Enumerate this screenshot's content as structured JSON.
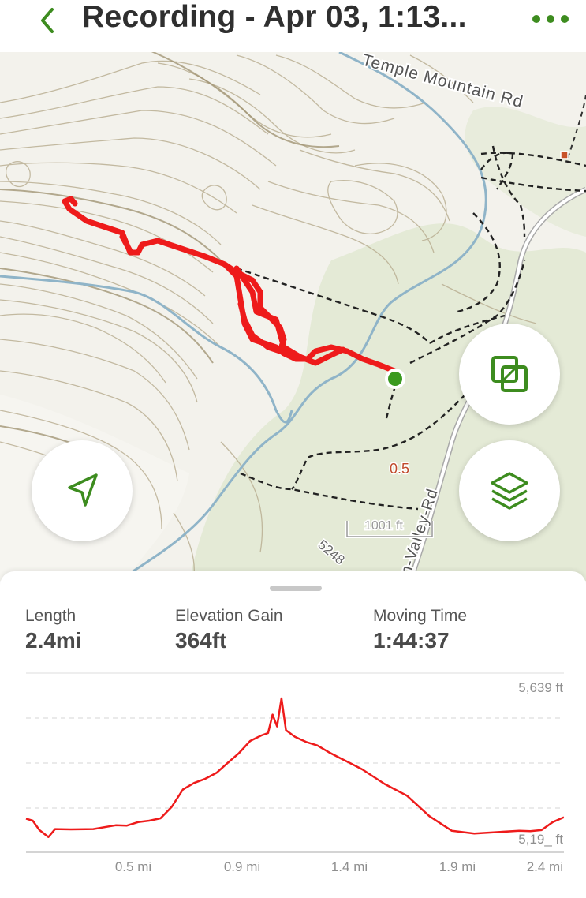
{
  "header": {
    "title": "Recording - Apr 03, 1:13...",
    "back_icon": "chevron-left-icon",
    "more_icon": "more-horizontal-icon",
    "accent_color": "#3d8c1f"
  },
  "map": {
    "road_1": "Temple Mountain Rd",
    "road_2": "n-Valley-Rd",
    "scale_label": "1001 ft",
    "mile_marker": "0.5",
    "contour_label": "5248",
    "track_color": "#ee1b1b",
    "buttons": {
      "locate_icon": "navigation-arrow-icon",
      "overlay_icon": "map-overlay-icon",
      "layers_icon": "layers-icon"
    }
  },
  "stats": {
    "length_label": "Length",
    "length_value": "2.4mi",
    "gain_label": "Elevation Gain",
    "gain_value": "364ft",
    "time_label": "Moving Time",
    "time_value": "1:44:37"
  },
  "chart_data": {
    "type": "line",
    "title": "",
    "xlabel": "",
    "ylabel": "",
    "x_ticks": [
      "0.5 mi",
      "0.9 mi",
      "1.4 mi",
      "1.9 mi",
      "2.4 mi"
    ],
    "y_ticks": [
      "5,639 ft",
      "5,19_ ft"
    ],
    "ylim": [
      5195,
      5639
    ],
    "xlim": [
      0,
      2.4
    ],
    "grid": true,
    "series": [
      {
        "color": "#ee1b1b",
        "x": [
          0.0,
          0.03,
          0.06,
          0.1,
          0.13,
          0.2,
          0.3,
          0.4,
          0.45,
          0.5,
          0.55,
          0.6,
          0.65,
          0.7,
          0.75,
          0.8,
          0.85,
          0.9,
          0.95,
          1.0,
          1.05,
          1.08,
          1.1,
          1.12,
          1.14,
          1.16,
          1.2,
          1.25,
          1.3,
          1.35,
          1.4,
          1.45,
          1.5,
          1.6,
          1.7,
          1.8,
          1.9,
          2.0,
          2.1,
          2.2,
          2.25,
          2.3,
          2.35,
          2.4
        ],
        "y": [
          5251,
          5245,
          5218,
          5198,
          5221,
          5220,
          5221,
          5232,
          5231,
          5241,
          5245,
          5252,
          5285,
          5335,
          5354,
          5366,
          5383,
          5412,
          5440,
          5475,
          5491,
          5498,
          5551,
          5517,
          5598,
          5506,
          5487,
          5472,
          5462,
          5443,
          5426,
          5410,
          5393,
          5351,
          5317,
          5258,
          5216,
          5208,
          5212,
          5216,
          5215,
          5218,
          5241,
          5255
        ]
      }
    ]
  }
}
